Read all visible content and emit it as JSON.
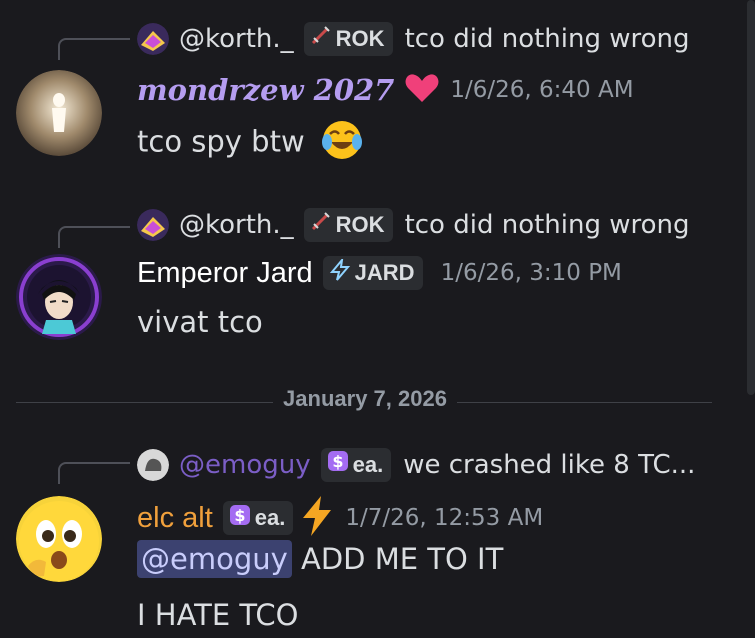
{
  "messages": [
    {
      "reply": {
        "name": "@korth._",
        "tag_icon": "sword-icon",
        "tag": "ROK",
        "text": "tco did nothing wrong"
      },
      "author": "mondrzew 2027",
      "author_color": "#b59df0",
      "badge_icon": "heart-icon",
      "time": "1/6/26, 6:40 AM",
      "content": "tco spy btw",
      "content_emoji": "joy-emoji"
    },
    {
      "reply": {
        "name": "@korth._",
        "tag_icon": "sword-icon",
        "tag": "ROK",
        "text": "tco did nothing wrong"
      },
      "author": "Emperor Jard",
      "author_color": "#ffffff",
      "author_tag_icon": "lightning-icon",
      "author_tag": "JARD",
      "time": "1/6/26, 3:10 PM",
      "content": "vivat tco"
    },
    {
      "reply": {
        "name": "@emoguy",
        "tag_icon": "dollar-icon",
        "tag": "ea.",
        "text": "we crashed like 8 TC..."
      },
      "author": "elc alt",
      "author_color": "#f0a03c",
      "author_tag_icon": "dollar-icon",
      "author_tag": "ea.",
      "badge_icon": "lightning-icon",
      "time": "1/7/26, 12:53 AM",
      "mention": "@emoguy",
      "content": "ADD ME TO IT",
      "content2": "I HATE TCO"
    }
  ],
  "date_divider": "January 7, 2026",
  "colors": {
    "background": "#1a1a1e",
    "mention_bg": "#3c4270",
    "timestamp": "#949ba4"
  }
}
